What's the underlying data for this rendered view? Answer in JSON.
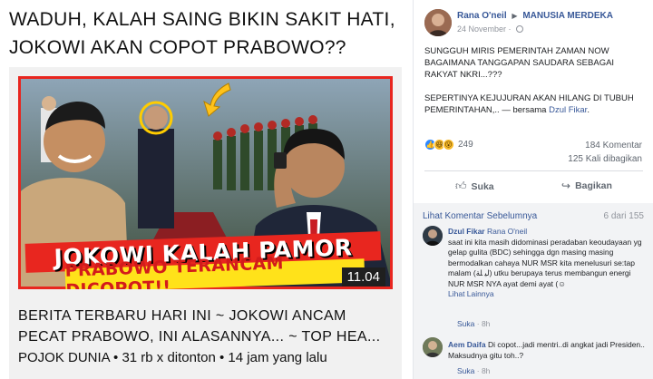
{
  "headline": "WADUH, KALAH SAING BIKIN SAKIT HATI, JOKOWI AKAN COPOT PRABOWO??",
  "video": {
    "banner_line1": "JOKOWI KALAH PAMOR",
    "banner_line2": "PRABOWO TERANCAM DICOPOT!!",
    "duration": "11.04",
    "title": "BERITA TERBARU HARI INI ~ JOKOWI ANCAM PECAT PRABOWO, INI ALASANNYA... ~ TOP HEA...",
    "meta": "POJOK DUNIA • 31 rb x ditonton • 14 jam yang lalu"
  },
  "post": {
    "author": "Rana O'neil",
    "arrow": "▶",
    "group": "MANUSIA MERDEKA",
    "date": "24 November · ",
    "paragraph1": "SUNGGUH MIRIS PEMERINTAH ZAMAN NOW BAGAIMANA TANGGAPAN SAUDARA SEBAGAI RAKYAT NKRI...???",
    "paragraph2_text": "SEPERTINYA KEJUJURAN AKAN HILANG DI TUBUH PEMERINTAHAN,.. — bersama ",
    "paragraph2_link": "Dzul Fikar",
    "paragraph2_end": ".",
    "reaction_count": "249",
    "comment_count": "184 Komentar",
    "share_count": "125 Kali dibagikan",
    "like_label": "Suka",
    "share_label": "Bagikan",
    "like_icon": "thumbs-up-icon",
    "share_icon": "share-icon"
  },
  "comments": {
    "prev_label": "Lihat Komentar Sebelumnya",
    "count_label": "6 dari 155",
    "items": [
      {
        "name": "Dzul Fikar",
        "tag": "Rana O'neil",
        "text": "saat ini kita masih didominasi peradaban keoudayaan yg gelap gulita (BDC) sehingga dgn masing masing bermodalkan cahaya NUR MSR kita menelusuri se:tap malam (ﻟﻴ ﻠﺔ) utku berupaya terus membangun energi NUR MSR NYA ayat demi ayat (☺",
        "more": "Lihat Lainnya",
        "like": "Suka",
        "time": "8h"
      },
      {
        "name": "Aem Daifa",
        "text": "Di copot...jadi mentri..di angkat jadi Presiden.. Maksudnya gitu toh..?",
        "like": "Suka",
        "time": "8h"
      }
    ]
  }
}
